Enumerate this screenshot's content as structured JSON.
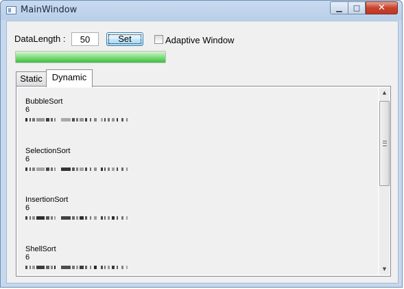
{
  "window": {
    "title": "MainWindow",
    "title_icon": "app-window-icon"
  },
  "titlebar": {
    "minimize_label": "▁",
    "maximize_label": "□",
    "close_label": "✕"
  },
  "toolbar": {
    "data_length_label": "DataLength :",
    "data_length_value": "50",
    "set_button_label": "Set",
    "adaptive_label": "Adaptive Window",
    "adaptive_checked": false
  },
  "progress": {
    "value_percent": 100
  },
  "tabs": [
    {
      "label": "Static",
      "selected": false
    },
    {
      "label": "Dynamic",
      "selected": true
    }
  ],
  "sort_items": [
    {
      "name": "BubbleSort",
      "value": "6"
    },
    {
      "name": "SelectionSort",
      "value": "6"
    },
    {
      "name": "InsertionSort",
      "value": "6"
    },
    {
      "name": "ShellSort",
      "value": "6"
    }
  ],
  "scrollbar": {
    "up_icon": "scroll-up-arrow-icon",
    "down_icon": "scroll-down-arrow-icon",
    "thumb_position_fraction": 0.0
  }
}
